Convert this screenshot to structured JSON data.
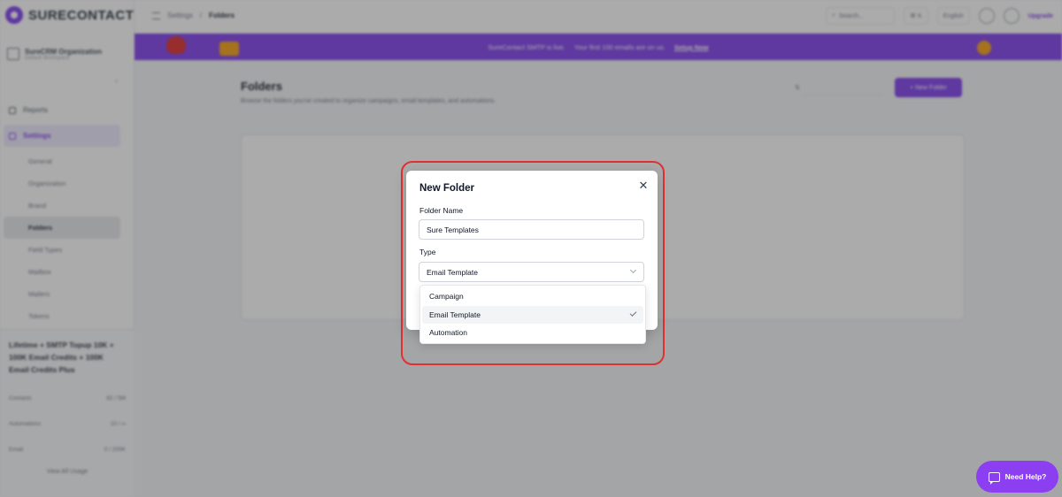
{
  "app": {
    "logo_text": "SURECONTACT",
    "organization": {
      "name": "SureCRM Organization",
      "sub": "Default Workspace"
    }
  },
  "sidebar": {
    "items": [
      {
        "label": "Reports"
      },
      {
        "label": "Settings"
      }
    ],
    "sub_items": [
      {
        "label": "General"
      },
      {
        "label": "Organization"
      },
      {
        "label": "Brand"
      },
      {
        "label": "Folders"
      },
      {
        "label": "Field Types"
      },
      {
        "label": "Mailbox"
      },
      {
        "label": "Mailers"
      },
      {
        "label": "Tokens"
      }
    ],
    "plan": {
      "title": "Lifetime + SMTP Topup 10K + 100K Email Credits + 100K Email Credits Plus",
      "rows": [
        {
          "label": "Contacts",
          "value": "82 / 5M"
        },
        {
          "label": "Automations",
          "value": "10 / ∞"
        },
        {
          "label": "Email",
          "value": "0 / 200K"
        }
      ],
      "link": "View All Usage"
    }
  },
  "topbar": {
    "breadcrumb": [
      "Settings",
      "Folders"
    ],
    "search_placeholder": "Search...",
    "language": "English",
    "upgrade": "Upgrade"
  },
  "banner": {
    "text": "SureContact SMTP is live.",
    "sub": "Your first 100 emails are on us.",
    "link": "Setup Now"
  },
  "page": {
    "title": "Folders",
    "description": "Browse the folders you've created to organize campaigns, email templates, and automations.",
    "new_folder_button": "+ New Folder"
  },
  "modal": {
    "title": "New Folder",
    "close_glyph": "✕",
    "folder_name_label": "Folder Name",
    "folder_name_value": "Sure Templates",
    "type_label": "Type",
    "type_selected": "Email Template",
    "type_options": [
      {
        "label": "Campaign",
        "selected": false
      },
      {
        "label": "Email Template",
        "selected": true
      },
      {
        "label": "Automation",
        "selected": false
      }
    ]
  },
  "help_button": {
    "label": "Need Help?"
  },
  "colors": {
    "brand": "#7c3aed",
    "highlight": "#e03030",
    "help": "#8b3ff0"
  }
}
